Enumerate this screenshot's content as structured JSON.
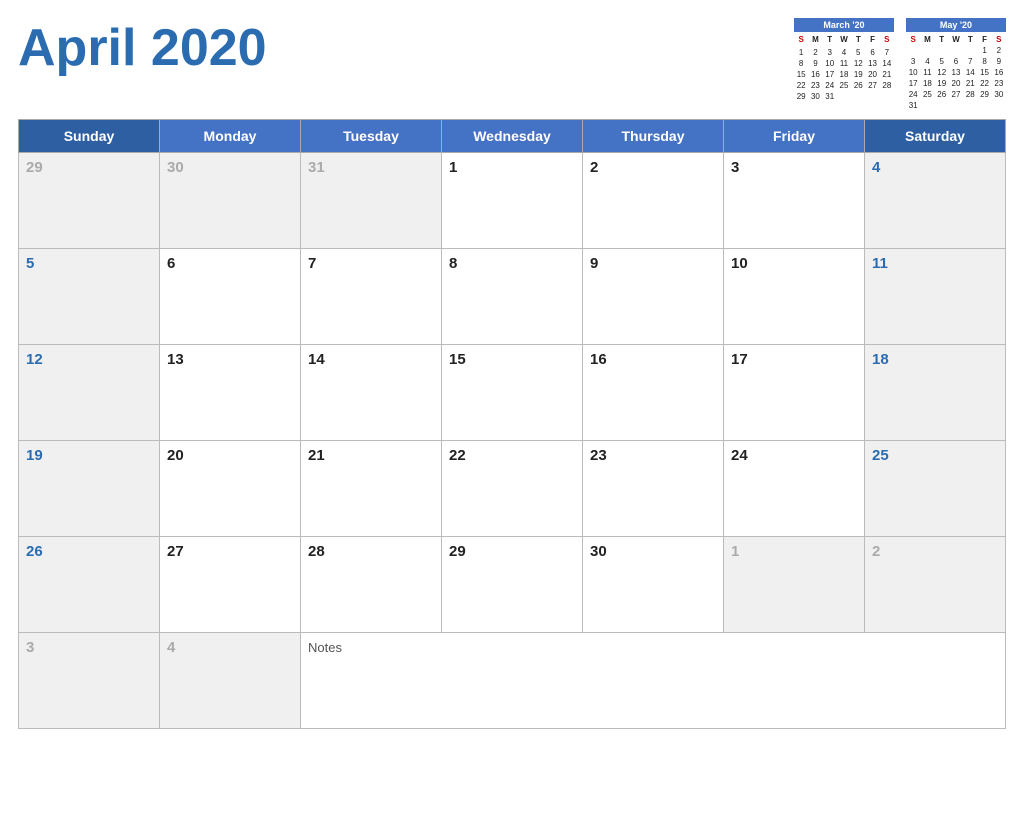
{
  "title": "April 2020",
  "accent_color": "#2B6CB0",
  "header_bg": "#4472C4",
  "mini_calendars": [
    {
      "label": "March '20",
      "class": "march",
      "days_header": [
        "S",
        "M",
        "T",
        "W",
        "T",
        "F",
        "S"
      ],
      "weeks": [
        [
          "",
          "",
          "",
          "",
          "",
          "",
          ""
        ],
        [
          "1",
          "2",
          "3",
          "4",
          "5",
          "6",
          "7"
        ],
        [
          "8",
          "9",
          "10",
          "11",
          "12",
          "13",
          "14"
        ],
        [
          "15",
          "16",
          "17",
          "18",
          "19",
          "20",
          "21"
        ],
        [
          "22",
          "23",
          "24",
          "25",
          "26",
          "27",
          "28"
        ],
        [
          "29",
          "30",
          "31",
          "",
          "",
          "",
          ""
        ]
      ]
    },
    {
      "label": "May '20",
      "class": "may",
      "days_header": [
        "S",
        "M",
        "T",
        "W",
        "T",
        "F",
        "S"
      ],
      "weeks": [
        [
          "",
          "",
          "",
          "",
          "",
          "1",
          "2"
        ],
        [
          "3",
          "4",
          "5",
          "6",
          "7",
          "8",
          "9"
        ],
        [
          "10",
          "11",
          "12",
          "13",
          "14",
          "15",
          "16"
        ],
        [
          "17",
          "18",
          "19",
          "20",
          "21",
          "22",
          "23"
        ],
        [
          "24",
          "25",
          "26",
          "27",
          "28",
          "29",
          "30"
        ],
        [
          "31",
          "",
          "",
          "",
          "",
          "",
          ""
        ]
      ]
    }
  ],
  "weekdays": [
    "Sunday",
    "Monday",
    "Tuesday",
    "Wednesday",
    "Thursday",
    "Friday",
    "Saturday"
  ],
  "weeks": [
    [
      {
        "day": "29",
        "type": "outside"
      },
      {
        "day": "30",
        "type": "outside"
      },
      {
        "day": "31",
        "type": "outside"
      },
      {
        "day": "1",
        "type": "normal"
      },
      {
        "day": "2",
        "type": "normal"
      },
      {
        "day": "3",
        "type": "normal"
      },
      {
        "day": "4",
        "type": "weekend",
        "color": "blue"
      }
    ],
    [
      {
        "day": "5",
        "type": "sunday",
        "color": "blue"
      },
      {
        "day": "6",
        "type": "normal"
      },
      {
        "day": "7",
        "type": "normal"
      },
      {
        "day": "8",
        "type": "normal"
      },
      {
        "day": "9",
        "type": "normal"
      },
      {
        "day": "10",
        "type": "normal"
      },
      {
        "day": "11",
        "type": "weekend",
        "color": "blue"
      }
    ],
    [
      {
        "day": "12",
        "type": "sunday",
        "color": "blue"
      },
      {
        "day": "13",
        "type": "normal"
      },
      {
        "day": "14",
        "type": "normal"
      },
      {
        "day": "15",
        "type": "normal"
      },
      {
        "day": "16",
        "type": "normal"
      },
      {
        "day": "17",
        "type": "normal"
      },
      {
        "day": "18",
        "type": "weekend",
        "color": "blue"
      }
    ],
    [
      {
        "day": "19",
        "type": "sunday",
        "color": "blue"
      },
      {
        "day": "20",
        "type": "normal"
      },
      {
        "day": "21",
        "type": "normal"
      },
      {
        "day": "22",
        "type": "normal"
      },
      {
        "day": "23",
        "type": "normal"
      },
      {
        "day": "24",
        "type": "normal"
      },
      {
        "day": "25",
        "type": "weekend",
        "color": "blue"
      }
    ],
    [
      {
        "day": "26",
        "type": "sunday",
        "color": "blue"
      },
      {
        "day": "27",
        "type": "normal"
      },
      {
        "day": "28",
        "type": "normal"
      },
      {
        "day": "29",
        "type": "normal"
      },
      {
        "day": "30",
        "type": "normal"
      },
      {
        "day": "1",
        "type": "outside"
      },
      {
        "day": "2",
        "type": "outside-weekend"
      }
    ]
  ],
  "notes_row": [
    {
      "day": "3",
      "type": "outside"
    },
    {
      "day": "4",
      "type": "outside"
    },
    {
      "notes": "Notes",
      "type": "notes"
    }
  ]
}
